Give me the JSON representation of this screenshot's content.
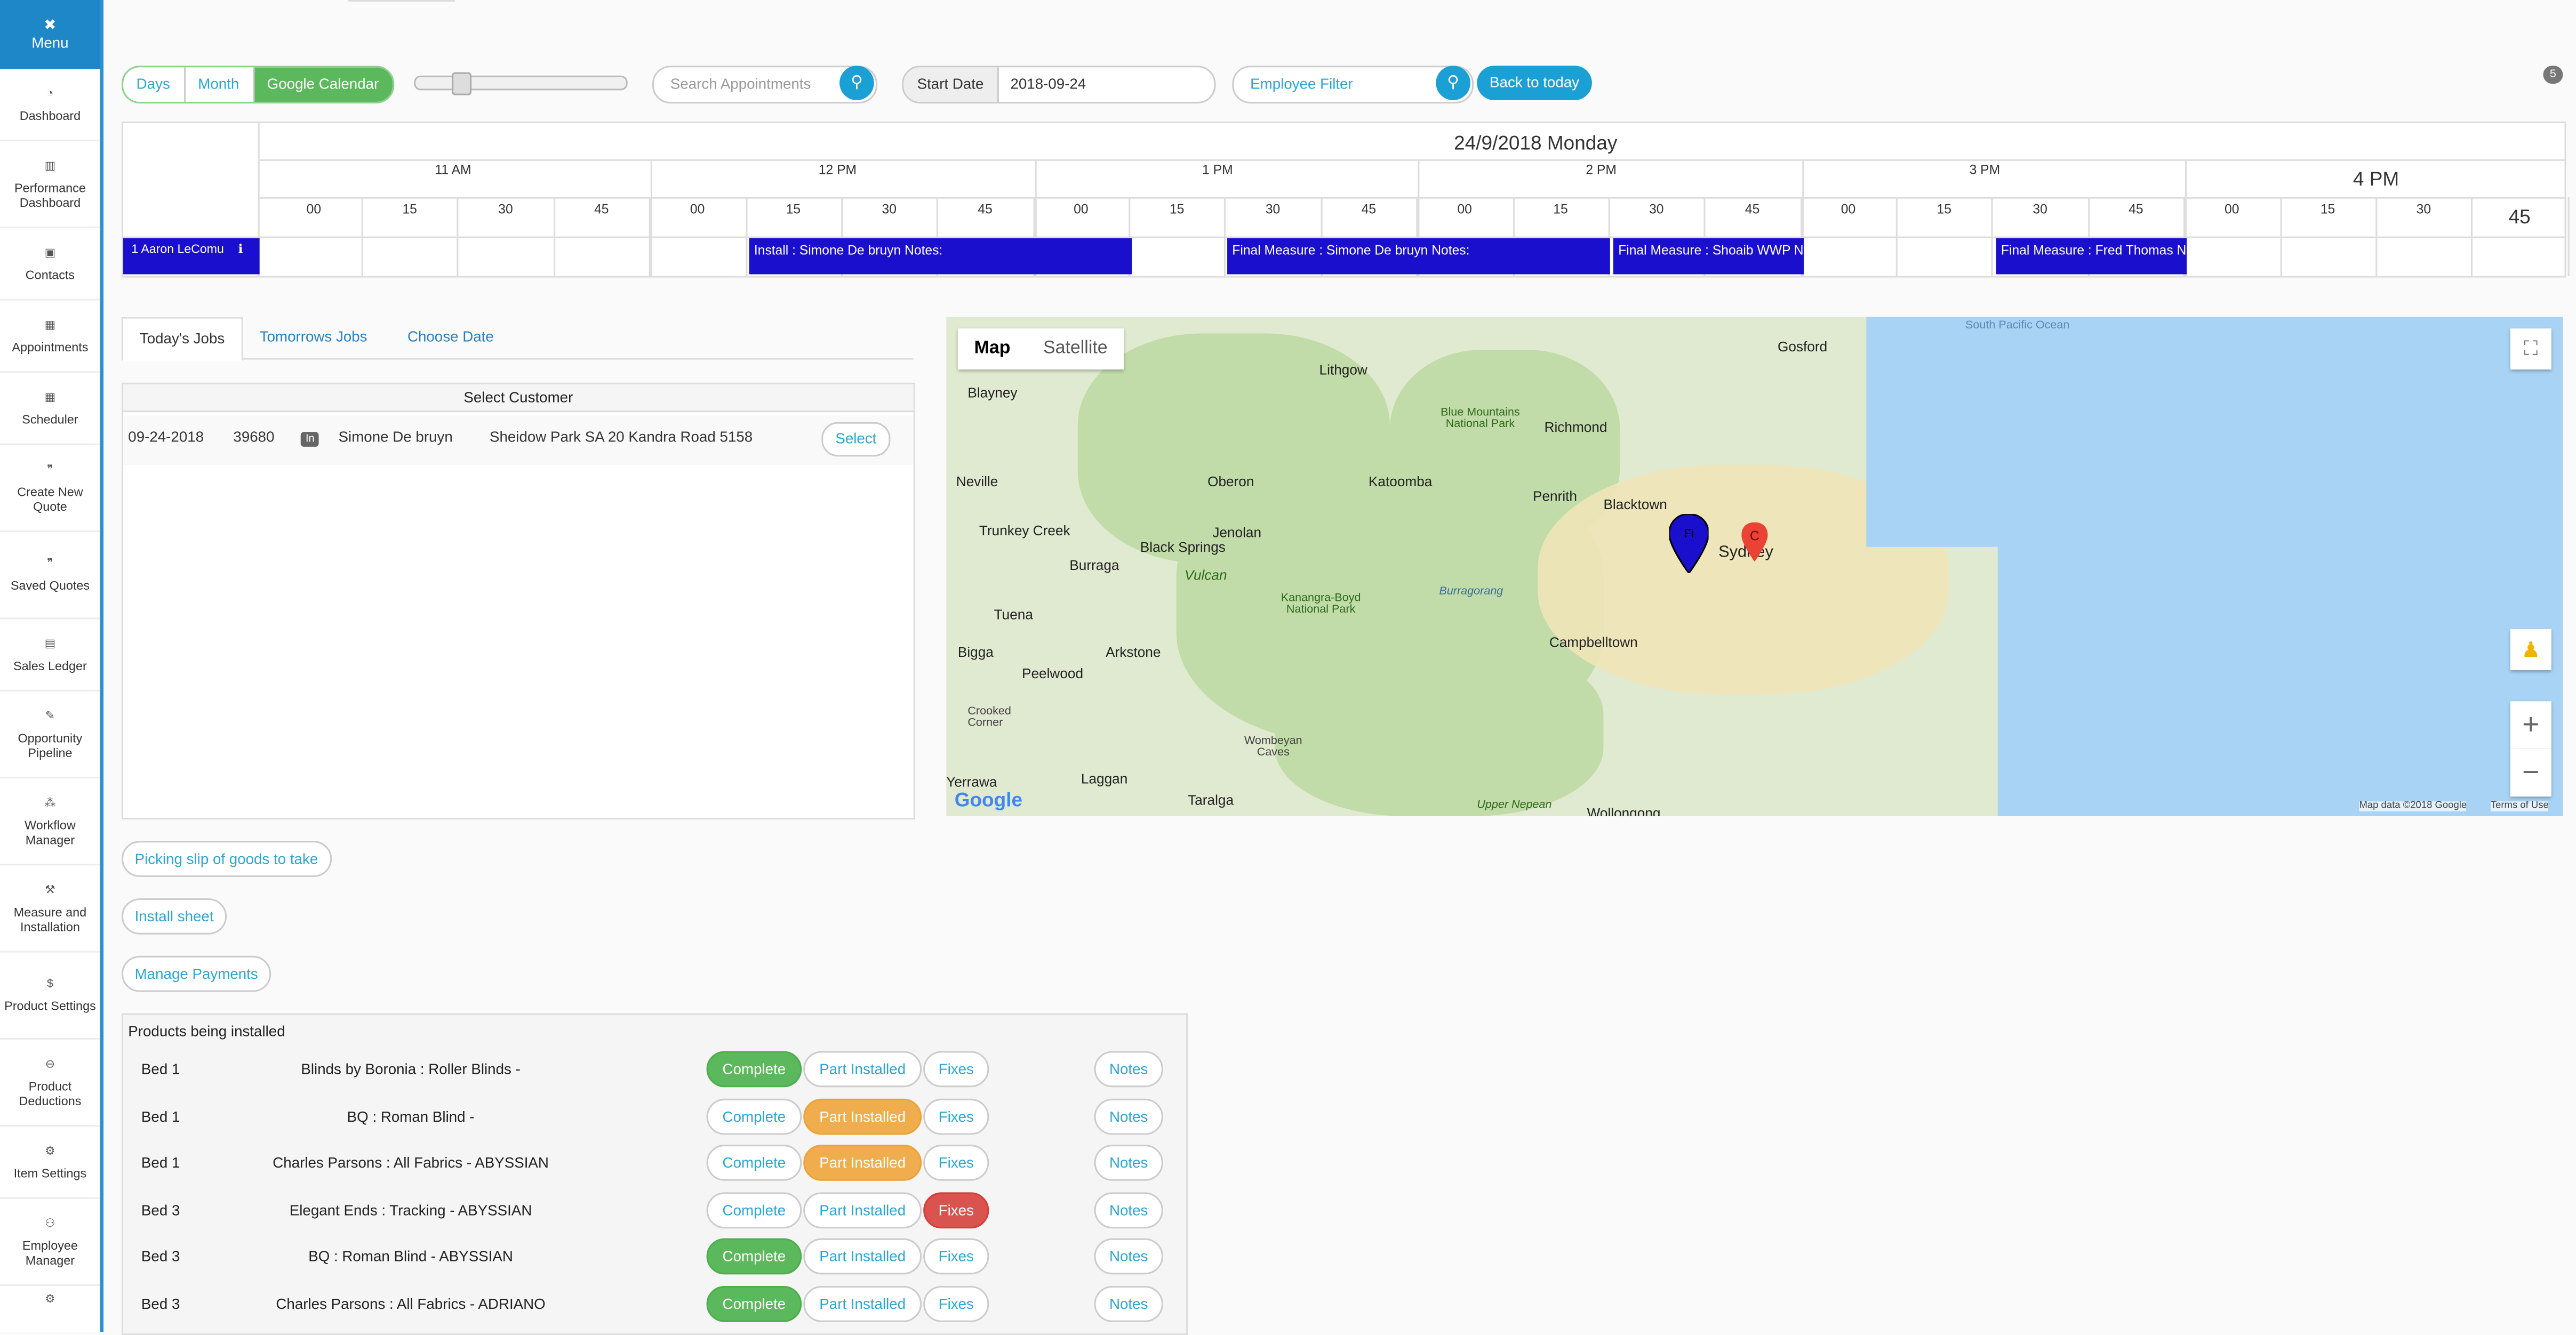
{
  "sidebar": {
    "menu_label": "Menu",
    "items": [
      {
        "label": "Dashboard"
      },
      {
        "label": "Performance Dashboard"
      },
      {
        "label": "Contacts"
      },
      {
        "label": "Appointments"
      },
      {
        "label": "Scheduler"
      },
      {
        "label": "Create New Quote"
      },
      {
        "label": "Saved Quotes"
      },
      {
        "label": "Sales Ledger"
      },
      {
        "label": "Opportunity Pipeline"
      },
      {
        "label": "Workflow Manager"
      },
      {
        "label": "Measure and Installation"
      },
      {
        "label": "Product Settings"
      },
      {
        "label": "Product Deductions"
      },
      {
        "label": "Item Settings"
      },
      {
        "label": "Employee Manager"
      }
    ]
  },
  "toolbar": {
    "views": [
      "Days",
      "Month",
      "Google Calendar"
    ],
    "active_view": "Google Calendar",
    "search_placeholder": "Search Appointments",
    "start_date_label": "Start Date",
    "start_date_value": "2018-09-24",
    "employee_filter_placeholder": "Employee Filter",
    "back_to_today": "Back to today",
    "notification_count": "5"
  },
  "calendar": {
    "date_title": "24/9/2018 Monday",
    "hours": [
      "11 AM",
      "12 PM",
      "1 PM",
      "2 PM",
      "3 PM",
      "4 PM"
    ],
    "minutes": [
      "00",
      "15",
      "30",
      "45"
    ],
    "employee": "1  Aaron LeComu",
    "appointments": [
      {
        "label": "Install : Simone De bruyn Notes:"
      },
      {
        "label": "Final Measure : Simone De bruyn Notes:"
      },
      {
        "label": "Final Measure : Shoaib WWP Notes:"
      },
      {
        "label": "Final Measure : Fred Thomas Notes:"
      }
    ]
  },
  "jobs": {
    "tabs": [
      "Today's Jobs",
      "Tomorrows Jobs",
      "Choose Date"
    ],
    "active_tab": "Today's Jobs",
    "header": "Select Customer",
    "rows": [
      {
        "date": "09-24-2018",
        "id": "39680",
        "badge": "In",
        "customer": "Simone De bruyn",
        "address": "Sheidow Park SA 20 Kandra Road 5158",
        "action": "Select"
      }
    ]
  },
  "map": {
    "tabs": [
      "Map",
      "Satellite"
    ],
    "active_tab": "Map",
    "attribution": "Map data ©2018 Google",
    "terms": "Terms of Use",
    "logo": "Google",
    "labels": [
      "Gosford",
      "South Pacific Ocean",
      "Lithgow",
      "Blayney",
      "Blue Mountains National Park",
      "Richmond",
      "Neville",
      "Oberon",
      "Katoomba",
      "Penrith",
      "Blacktown",
      "Trunkey Creek",
      "Jenolan",
      "Black Springs",
      "Burraga",
      "Vulcan",
      "Kanangra-Boyd National Park",
      "Burragorang",
      "Sydney",
      "Tuena",
      "Arkstone",
      "Campbelltown",
      "Bigga",
      "Peelwood",
      "Crooked Corner",
      "Wombeyan Caves",
      "Laggan",
      "Taralga",
      "Upper Nepean",
      "Wollongong",
      "Yerrawa"
    ],
    "pins": [
      {
        "label": "C"
      },
      {
        "label": "Fi"
      }
    ]
  },
  "actions": {
    "picking_slip": "Picking slip of goods to take",
    "install_sheet": "Install sheet",
    "manage_payments": "Manage Payments"
  },
  "products": {
    "title": "Products being installed",
    "status_labels": {
      "complete": "Complete",
      "part": "Part Installed",
      "fixes": "Fixes",
      "notes": "Notes"
    },
    "rows": [
      {
        "room": "Bed 1",
        "name": "Blinds by Boronia : Roller Blinds -",
        "status": "complete"
      },
      {
        "room": "Bed 1",
        "name": "BQ : Roman Blind -",
        "status": "part"
      },
      {
        "room": "Bed 1",
        "name": "Charles Parsons : All Fabrics - ABYSSIAN",
        "status": "part"
      },
      {
        "room": "Bed 3",
        "name": "Elegant Ends : Tracking - ABYSSIAN",
        "status": "fixes"
      },
      {
        "room": "Bed 3",
        "name": "BQ : Roman Blind - ABYSSIAN",
        "status": "complete"
      },
      {
        "room": "Bed 3",
        "name": "Charles Parsons : All Fabrics - ADRIANO",
        "status": "complete"
      }
    ]
  },
  "colors": {
    "accent": "#1ba0d6",
    "appointment": "#1a0fcc",
    "complete": "#5cb85c",
    "part": "#f0ad4e",
    "fixes": "#d9534f"
  }
}
